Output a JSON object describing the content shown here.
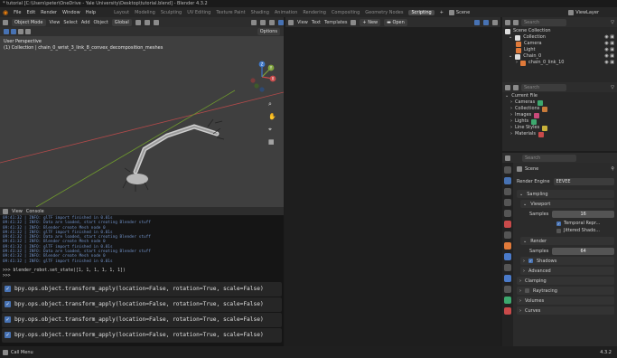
{
  "window_title": "* tutorial [C:\\Users\\peter\\OneDrive - Yale University\\Desktop\\tutorial.blend] - Blender 4.3.2",
  "menu": {
    "items": [
      "File",
      "Edit",
      "Render",
      "Window",
      "Help"
    ],
    "workspaces": [
      "Layout",
      "Modeling",
      "Sculpting",
      "UV Editing",
      "Texture Paint",
      "Shading",
      "Animation",
      "Rendering",
      "Compositing",
      "Geometry Nodes",
      "Scripting"
    ],
    "active_workspace": "Scripting",
    "scene": "Scene",
    "view_layer": "ViewLayer"
  },
  "viewport": {
    "mode": "Object Mode",
    "menus": [
      "View",
      "Select",
      "Add",
      "Object"
    ],
    "orientation": "Global",
    "options": "Options",
    "perspective": "User Perspective",
    "collection_info": "(1) Collection | chain_0_wrist_3_link_8_convex_decomposition_meshes",
    "gizmo": {
      "x": "X",
      "y": "Y",
      "z": "Z"
    },
    "colors": {
      "bg": "#3f3f3f",
      "x_axis": "#c94a4a",
      "y_axis": "#7fa33c",
      "z_axis": "#3f78c9"
    }
  },
  "text_editor": {
    "menus": [
      "View",
      "Text",
      "Templates"
    ],
    "new_label": "New",
    "open_label": "Open"
  },
  "console": {
    "menus": [
      "View",
      "Console"
    ],
    "logs": [
      "09:41:32 | INFO: glTF import finished in 0.01s",
      "09:41:32 | INFO: Data are loaded, start creating Blender stuff",
      "09:41:32 | INFO: Blender create Mesh node 0",
      "09:41:32 | INFO: glTF import finished in 0.01s",
      "09:41:32 | INFO: Data are loaded, start creating Blender stuff",
      "09:41:32 | INFO: Blender create Mesh node 0",
      "09:41:32 | INFO: glTF import finished in 0.01s",
      "09:41:32 | INFO: Data are loaded, start creating Blender stuff",
      "09:41:32 | INFO: Blender create Mesh node 0",
      "09:41:32 | INFO: glTF import finished in 0.01s"
    ],
    "command": ">>> blender_robot.set_state([1, 1, 1, 1, 1, 1])",
    "prompt": ">>> ",
    "history": [
      "bpy.ops.object.transform_apply(location=False, rotation=True, scale=False)",
      "bpy.ops.object.transform_apply(location=False, rotation=True, scale=False)",
      "bpy.ops.object.transform_apply(location=False, rotation=True, scale=False)",
      "bpy.ops.object.transform_apply(location=False, rotation=True, scale=False)"
    ]
  },
  "outliner": {
    "search_placeholder": "Search",
    "items": [
      "Scene Collection",
      "Collection",
      "Camera",
      "Light",
      "Chain_0",
      "chain_0_link_10"
    ]
  },
  "blend_file": {
    "search_placeholder": "Search",
    "items": [
      "Current File",
      "Cameras",
      "Collections",
      "Images",
      "Lights",
      "Line Styles",
      "Materials"
    ]
  },
  "properties": {
    "search_placeholder": "Search",
    "scene": "Scene",
    "render_engine_label": "Render Engine",
    "render_engine": "EEVEE",
    "sections": {
      "sampling": "Sampling",
      "viewport": "Viewport",
      "samples_label": "Samples",
      "viewport_samples": "16",
      "temporal": "Temporal Repr...",
      "jittered": "Jittered Shado...",
      "render": "Render",
      "render_samples": "64",
      "shadows": "Shadows",
      "advanced": "Advanced",
      "clamping": "Clamping",
      "raytracing": "Raytracing",
      "volumes": "Volumes",
      "curves": "Curves"
    }
  },
  "status": {
    "left": "Call Menu",
    "version": "4.3.2"
  }
}
